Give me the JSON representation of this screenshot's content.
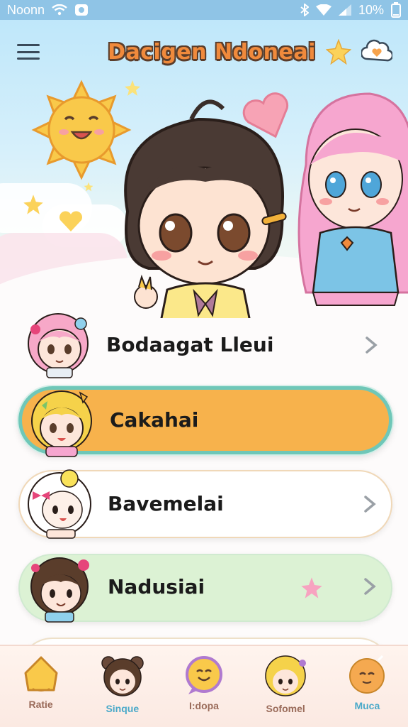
{
  "status_bar": {
    "carrier": "Noonn",
    "battery": "10%"
  },
  "header": {
    "title": "Dacigen Ndoneai"
  },
  "menu": {
    "items": [
      {
        "label": "Bodaagat Lleui",
        "style": "plain",
        "trailing": "chevron"
      },
      {
        "label": "Cakahai",
        "style": "selected",
        "trailing": "none"
      },
      {
        "label": "Bavemelai",
        "style": "white",
        "trailing": "chevron"
      },
      {
        "label": "Nadusiai",
        "style": "mint",
        "trailing": "star+chevron"
      }
    ]
  },
  "bottom_nav": {
    "items": [
      {
        "label": "Ratie",
        "icon": "house-icon",
        "color": "#9a6b5a"
      },
      {
        "label": "Sinque",
        "icon": "bear-girl-avatar",
        "color": "#4aa9c9"
      },
      {
        "label": "I:dopa",
        "icon": "smile-chat-icon",
        "color": "#9a6b5a"
      },
      {
        "label": "Sofomel",
        "icon": "blonde-girl-avatar",
        "color": "#9a6b5a"
      },
      {
        "label": "Muca",
        "icon": "orange-face-icon",
        "color": "#4aa9c9"
      }
    ]
  },
  "colors": {
    "accent_orange": "#f7b24c",
    "accent_teal": "#6fc7b8",
    "mint": "#dcf2d4",
    "status_bar": "#8fc4e6"
  }
}
